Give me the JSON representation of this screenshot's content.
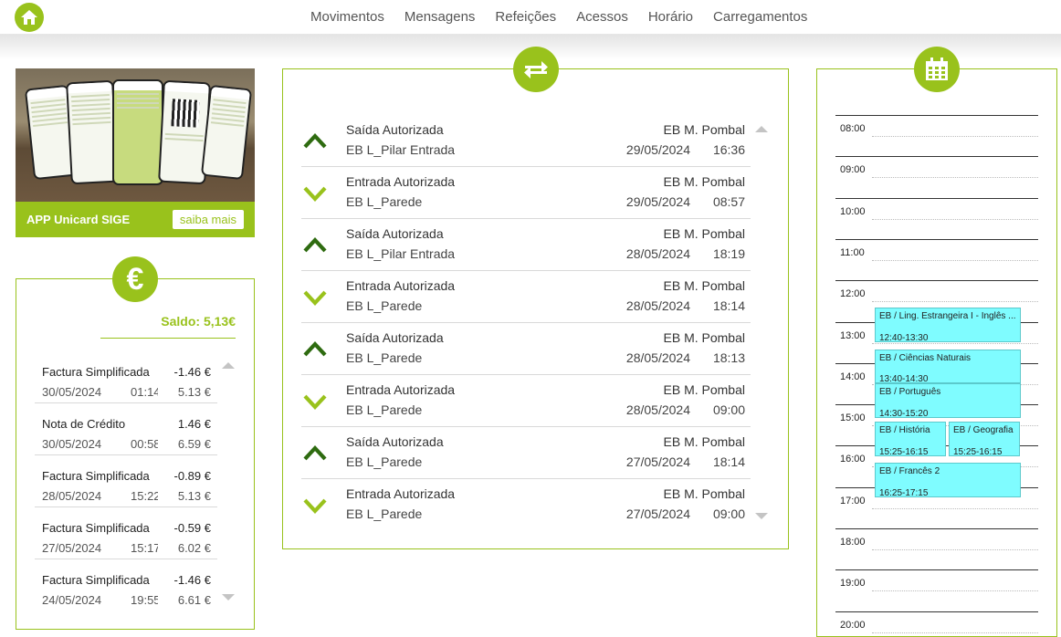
{
  "nav": {
    "items": [
      "Movimentos",
      "Mensagens",
      "Refeições",
      "Acessos",
      "Horário",
      "Carregamentos"
    ]
  },
  "promo": {
    "title": "APP Unicard SIGE",
    "button": "saiba mais"
  },
  "saldo": {
    "label": "Saldo: 5,13€",
    "transactions": [
      {
        "desc": "Factura Simplificada",
        "amount": "-1.46 €",
        "date": "30/05/2024",
        "time": "01:14",
        "balance": "5.13 €"
      },
      {
        "desc": "Nota de Crédito",
        "amount": "1.46 €",
        "date": "30/05/2024",
        "time": "00:58",
        "balance": "6.59 €"
      },
      {
        "desc": "Factura Simplificada",
        "amount": "-0.89 €",
        "date": "28/05/2024",
        "time": "15:22",
        "balance": "5.13 €"
      },
      {
        "desc": "Factura Simplificada",
        "amount": "-0.59 €",
        "date": "27/05/2024",
        "time": "15:17",
        "balance": "6.02 €"
      },
      {
        "desc": "Factura Simplificada",
        "amount": "-1.46 €",
        "date": "24/05/2024",
        "time": "19:55",
        "balance": "6.61 €"
      }
    ]
  },
  "movimentos": [
    {
      "dir": "up",
      "status": "Saída Autorizada",
      "location": "EB L_Pilar Entrada",
      "school": "EB M. Pombal",
      "date": "29/05/2024",
      "time": "16:36"
    },
    {
      "dir": "down",
      "status": "Entrada Autorizada",
      "location": "EB L_Parede",
      "school": "EB M. Pombal",
      "date": "29/05/2024",
      "time": "08:57"
    },
    {
      "dir": "up",
      "status": "Saída Autorizada",
      "location": "EB L_Pilar Entrada",
      "school": "EB M. Pombal",
      "date": "28/05/2024",
      "time": "18:19"
    },
    {
      "dir": "down",
      "status": "Entrada Autorizada",
      "location": "EB L_Parede",
      "school": "EB M. Pombal",
      "date": "28/05/2024",
      "time": "18:14"
    },
    {
      "dir": "up",
      "status": "Saída Autorizada",
      "location": "EB L_Parede",
      "school": "EB M. Pombal",
      "date": "28/05/2024",
      "time": "18:13"
    },
    {
      "dir": "down",
      "status": "Entrada Autorizada",
      "location": "EB L_Parede",
      "school": "EB M. Pombal",
      "date": "28/05/2024",
      "time": "09:00"
    },
    {
      "dir": "up",
      "status": "Saída Autorizada",
      "location": "EB L_Parede",
      "school": "EB M. Pombal",
      "date": "27/05/2024",
      "time": "18:14"
    },
    {
      "dir": "down",
      "status": "Entrada Autorizada",
      "location": "EB L_Parede",
      "school": "EB M. Pombal",
      "date": "27/05/2024",
      "time": "09:00"
    }
  ],
  "horario": {
    "hours": [
      "08:00",
      "09:00",
      "10:00",
      "11:00",
      "12:00",
      "13:00",
      "14:00",
      "15:00",
      "16:00",
      "17:00",
      "18:00",
      "19:00",
      "20:00"
    ],
    "events": [
      {
        "name": "EB / Ling. Estrangeira I - Inglês ...",
        "time": "12:40-13:30"
      },
      {
        "name": "EB / Ciências Naturais",
        "time": "13:40-14:30"
      },
      {
        "name": "EB / Português",
        "time": "14:30-15:20"
      },
      {
        "name": "EB / História",
        "time": "15:25-16:15"
      },
      {
        "name": "EB / Geografia",
        "time": "15:25-16:15"
      },
      {
        "name": "EB / Francês 2",
        "time": "16:25-17:15"
      }
    ]
  },
  "colors": {
    "accent": "#99c21c",
    "dark_green": "#2e6b10",
    "event_bg": "#7ffcff"
  }
}
